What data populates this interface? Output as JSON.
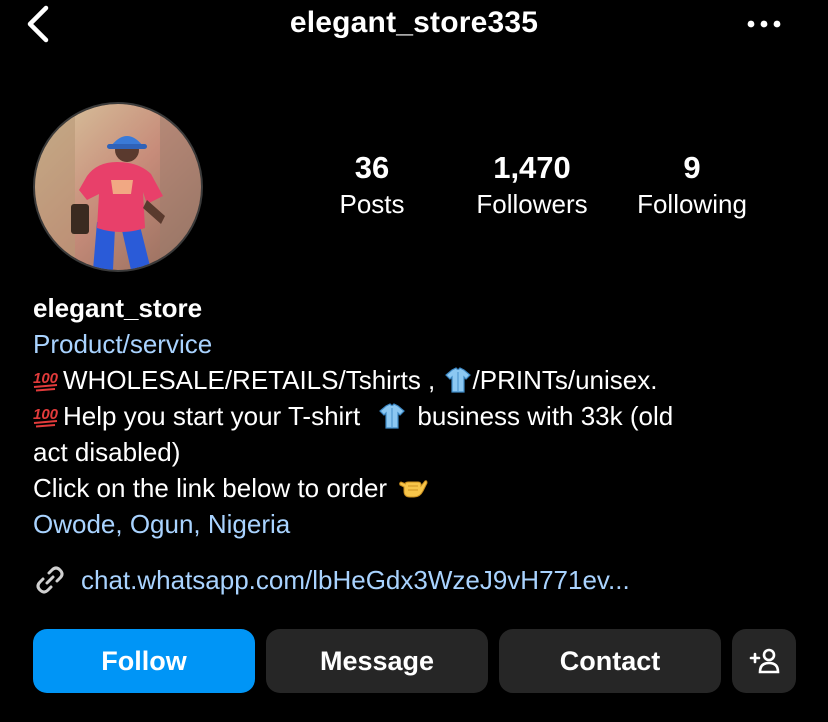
{
  "header": {
    "username": "elegant_store335",
    "back_icon": "chevron-left-icon",
    "more_icon": "more-horizontal-icon"
  },
  "profile": {
    "avatar_icon": "profile-avatar",
    "stats": [
      {
        "value": "36",
        "label": "Posts"
      },
      {
        "value": "1,470",
        "label": "Followers"
      },
      {
        "value": "9",
        "label": "Following"
      }
    ]
  },
  "bio": {
    "name": "elegant_store",
    "category": "Product/service",
    "line1_a": "WHOLESALE/RETAILS/Tshirts ,",
    "line1_b": "/PRINTs/unisex.",
    "line2_a": "Help you start your T-shirt",
    "line2_b": "business with 33k (old",
    "line3": "act disabled)",
    "line4": "Click on the link below to order",
    "location": "Owode, Ogun, Nigeria"
  },
  "link": {
    "icon": "link-icon",
    "text": "chat.whatsapp.com/lbHeGdx3WzeJ9vH771ev..."
  },
  "actions": {
    "follow": "Follow",
    "message": "Message",
    "contact": "Contact",
    "add_user_icon": "add-user-icon"
  },
  "colors": {
    "background": "#000000",
    "follow_button": "#0095f6",
    "secondary_button": "#262626",
    "link_text": "#a9d3ff"
  }
}
